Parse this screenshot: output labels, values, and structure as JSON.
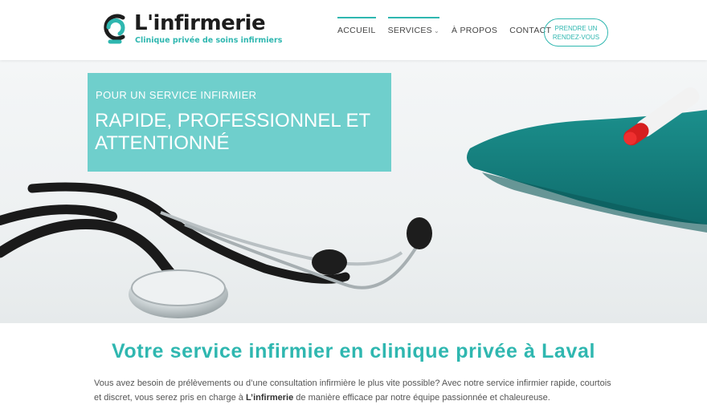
{
  "brand": {
    "name": "L'infirmerie",
    "tagline": "Clinique privée de soins infirmiers",
    "accent": "#2fb7b0",
    "logo_icon": "logo-mark-icon"
  },
  "nav": {
    "items": [
      {
        "label": "Accueil",
        "active": true
      },
      {
        "label": "Services",
        "has_dropdown": true
      },
      {
        "label": "À propos"
      },
      {
        "label": "Contact"
      }
    ],
    "cta_label": "Prendre un rendez-vous"
  },
  "hero": {
    "kicker": "POUR UN SERVICE INFIRMIER",
    "title": "RAPIDE, PROFESSIONNEL ET ATTENTIONNÉ",
    "box_color": "#6fcfcc"
  },
  "content": {
    "title": "Votre service infirmier en clinique privée à Laval",
    "paragraph_part1": "Vous avez besoin de prélèvements ou d’une consultation infirmière le plus vite possible? Avec notre service infirmier rapide, courtois et discret, vous serez pris en charge à ",
    "paragraph_bold": "L’infirmerie",
    "paragraph_part2": " de manière efficace par notre équipe passionnée et chaleureuse."
  }
}
